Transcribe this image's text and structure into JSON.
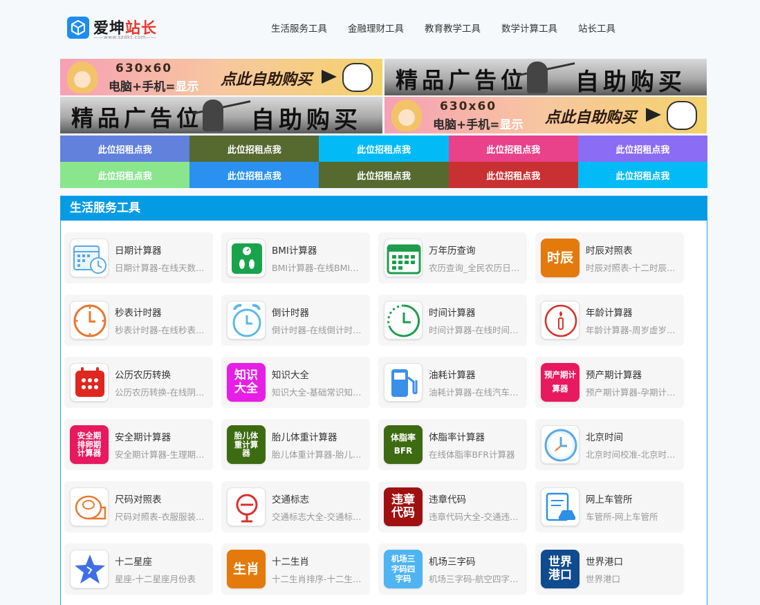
{
  "site": {
    "logo_main": "爱坤",
    "logo_accent": "站长",
    "logo_url": "——www.szdkt.com——"
  },
  "nav": [
    "生活服务工具",
    "金融理财工具",
    "教育教学工具",
    "数学计算工具",
    "站长工具"
  ],
  "banners": {
    "ad630_size": "630x60",
    "ad630_line_a": "电脑+手机=",
    "ad630_line_hl": "显示",
    "ad630_cta": "点此自助购买",
    "premium_a": "精品广告位",
    "premium_b": "自助购买"
  },
  "rent_slots": [
    {
      "label": "此位招租点我",
      "color": "#6281dd"
    },
    {
      "label": "此位招租点我",
      "color": "#56692f"
    },
    {
      "label": "此位招租点我",
      "color": "#02bbf6"
    },
    {
      "label": "此位招租点我",
      "color": "#e9418a"
    },
    {
      "label": "此位招租点我",
      "color": "#8b6cf4"
    },
    {
      "label": "此位招租点我",
      "color": "#89e68c"
    },
    {
      "label": "此位招租点我",
      "color": "#2b91f0"
    },
    {
      "label": "此位招租点我",
      "color": "#56692f"
    },
    {
      "label": "此位招租点我",
      "color": "#c93031"
    },
    {
      "label": "此位招租点我",
      "color": "#02bbf6"
    }
  ],
  "section": {
    "title": "生活服务工具",
    "tools": [
      {
        "title": "日期计算器",
        "desc": "日期计算器-在线天数计算器",
        "icon": "calendar-clock-icon"
      },
      {
        "title": "BMI计算器",
        "desc": "BMI计算器-在线BMI指数计算",
        "icon": "scale-icon"
      },
      {
        "title": "万年历查询",
        "desc": "农历查询_全民农历日历查询",
        "icon": "calendar-icon"
      },
      {
        "title": "时辰对照表",
        "desc": "时辰对照表-十二时辰对照表",
        "icon": "shichen-icon",
        "icon_text": "时辰"
      },
      {
        "title": "秒表计时器",
        "desc": "秒表计时器-在线秒表计时器",
        "icon": "stopwatch-icon"
      },
      {
        "title": "倒计时器",
        "desc": "倒计时器-在线倒计时器工具",
        "icon": "alarm-clock-icon"
      },
      {
        "title": "时间计算器",
        "desc": "时间计算器-在线时间计算器",
        "icon": "timer-icon"
      },
      {
        "title": "年龄计算器",
        "desc": "年龄计算器-周岁虚岁计算器",
        "icon": "candle-icon"
      },
      {
        "title": "公历农历转换",
        "desc": "公历农历转换-在线阴阳历转换",
        "icon": "calendar-grid-icon"
      },
      {
        "title": "知识大全",
        "desc": "知识大全-基础常识知识大全",
        "icon": "knowledge-icon",
        "icon_text": "知识大全"
      },
      {
        "title": "油耗计算器",
        "desc": "油耗计算器-在线汽车油耗计算",
        "icon": "fuel-pump-icon"
      },
      {
        "title": "预产期计算器",
        "desc": "预产期计算器-孕期计算器",
        "icon": "due-date-icon",
        "icon_text": "预产期计算器"
      },
      {
        "title": "安全期计算器",
        "desc": "安全期计算器-生理期计算器",
        "icon": "safe-period-icon",
        "icon_text": "安全期排卵期计算器"
      },
      {
        "title": "胎儿体重计算器",
        "desc": "胎儿体重计算器-胎儿体重计算",
        "icon": "fetal-weight-icon",
        "icon_text": "胎儿体重计算器"
      },
      {
        "title": "体脂率计算器",
        "desc": "在线体脂率BFR计算器",
        "icon": "body-fat-icon",
        "icon_text": "体脂率BFR"
      },
      {
        "title": "北京时间",
        "desc": "北京时间校准-北京时间在线",
        "icon": "clock-icon"
      },
      {
        "title": "尺码对照表",
        "desc": "尺码对照表-衣服服装尺码表",
        "icon": "tape-measure-icon"
      },
      {
        "title": "交通标志",
        "desc": "交通标志大全-交通标志图解",
        "icon": "traffic-sign-icon"
      },
      {
        "title": "违章代码",
        "desc": "违章代码大全-交通违章代码",
        "icon": "violation-code-icon",
        "icon_text": "违章代码"
      },
      {
        "title": "网上车管所",
        "desc": "车管所-网上车管所",
        "icon": "vehicle-office-icon"
      },
      {
        "title": "十二星座",
        "desc": "星座-十二星座月份表",
        "icon": "star-icon"
      },
      {
        "title": "十二生肖",
        "desc": "十二生肖排序-十二生肖查询",
        "icon": "zodiac-icon",
        "icon_text": "生肖"
      },
      {
        "title": "机场三字码",
        "desc": "机场三字码-航空四字码查询",
        "icon": "airport-code-icon",
        "icon_text": "机场三字码四字码"
      },
      {
        "title": "世界港口",
        "desc": "世界港口",
        "icon": "world-port-icon",
        "icon_text": "世界港口"
      }
    ]
  }
}
